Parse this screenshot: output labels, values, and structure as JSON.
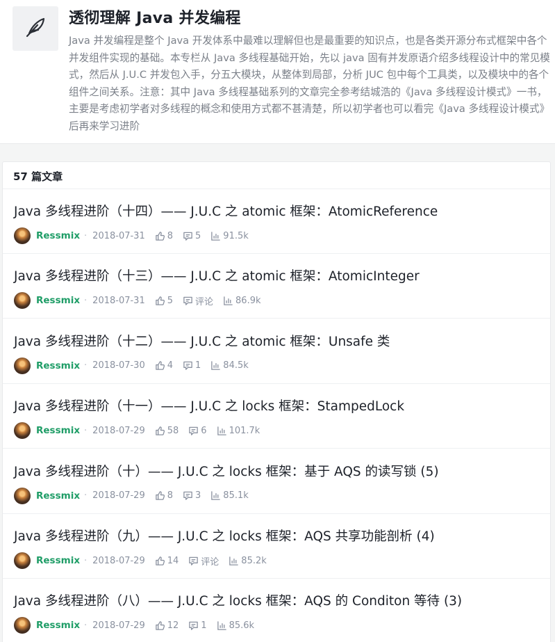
{
  "column": {
    "title": "透彻理解 Java 并发编程",
    "description": "Java 并发编程是整个 Java 开发体系中最难以理解但也是最重要的知识点，也是各类开源分布式框架中各个并发组件实现的基础。本专栏从 Java 多线程基础开始，先以 java 固有并发原语介绍多线程设计中的常见模式，然后从 J.U.C 并发包入手，分五大模块，从整体到局部，分析 JUC 包中每个工具类，以及模块中的各个组件之间关系。注意：其中 Java 多线程基础系列的文章完全参考结城浩的《Java 多线程设计模式》一书，主要是考虑初学者对多线程的概念和使用方式都不甚清楚，所以初学者也可以看完《Java 多线程设计模式》后再来学习进阶",
    "cover_icon": "feather-icon"
  },
  "list": {
    "count_label": "57 篇文章",
    "articles": [
      {
        "title": "Java 多线程进阶（十四）—— J.U.C 之 atomic 框架：AtomicReference",
        "author": "Ressmix",
        "date": "2018-07-31",
        "likes": "8",
        "comments": "5",
        "views": "91.5k"
      },
      {
        "title": "Java 多线程进阶（十三）—— J.U.C 之 atomic 框架：AtomicInteger",
        "author": "Ressmix",
        "date": "2018-07-31",
        "likes": "5",
        "comments": "评论",
        "views": "86.9k"
      },
      {
        "title": "Java 多线程进阶（十二）—— J.U.C 之 atomic 框架：Unsafe 类",
        "author": "Ressmix",
        "date": "2018-07-30",
        "likes": "4",
        "comments": "1",
        "views": "84.5k"
      },
      {
        "title": "Java 多线程进阶（十一）—— J.U.C 之 locks 框架：StampedLock",
        "author": "Ressmix",
        "date": "2018-07-29",
        "likes": "58",
        "comments": "6",
        "views": "101.7k"
      },
      {
        "title": "Java 多线程进阶（十）—— J.U.C 之 locks 框架：基于 AQS 的读写锁 (5)",
        "author": "Ressmix",
        "date": "2018-07-29",
        "likes": "8",
        "comments": "3",
        "views": "85.1k"
      },
      {
        "title": "Java 多线程进阶（九）—— J.U.C 之 locks 框架：AQS 共享功能剖析 (4)",
        "author": "Ressmix",
        "date": "2018-07-29",
        "likes": "14",
        "comments": "评论",
        "views": "85.2k"
      },
      {
        "title": "Java 多线程进阶（八）—— J.U.C 之 locks 框架：AQS 的 Conditon 等待 (3)",
        "author": "Ressmix",
        "date": "2018-07-29",
        "likes": "12",
        "comments": "1",
        "views": "85.6k"
      }
    ]
  },
  "meta_separator": "·",
  "colors": {
    "author": "#1f9d67",
    "meta": "#8a919f",
    "title": "#1d2129",
    "page_bg": "#f4f5f5"
  }
}
